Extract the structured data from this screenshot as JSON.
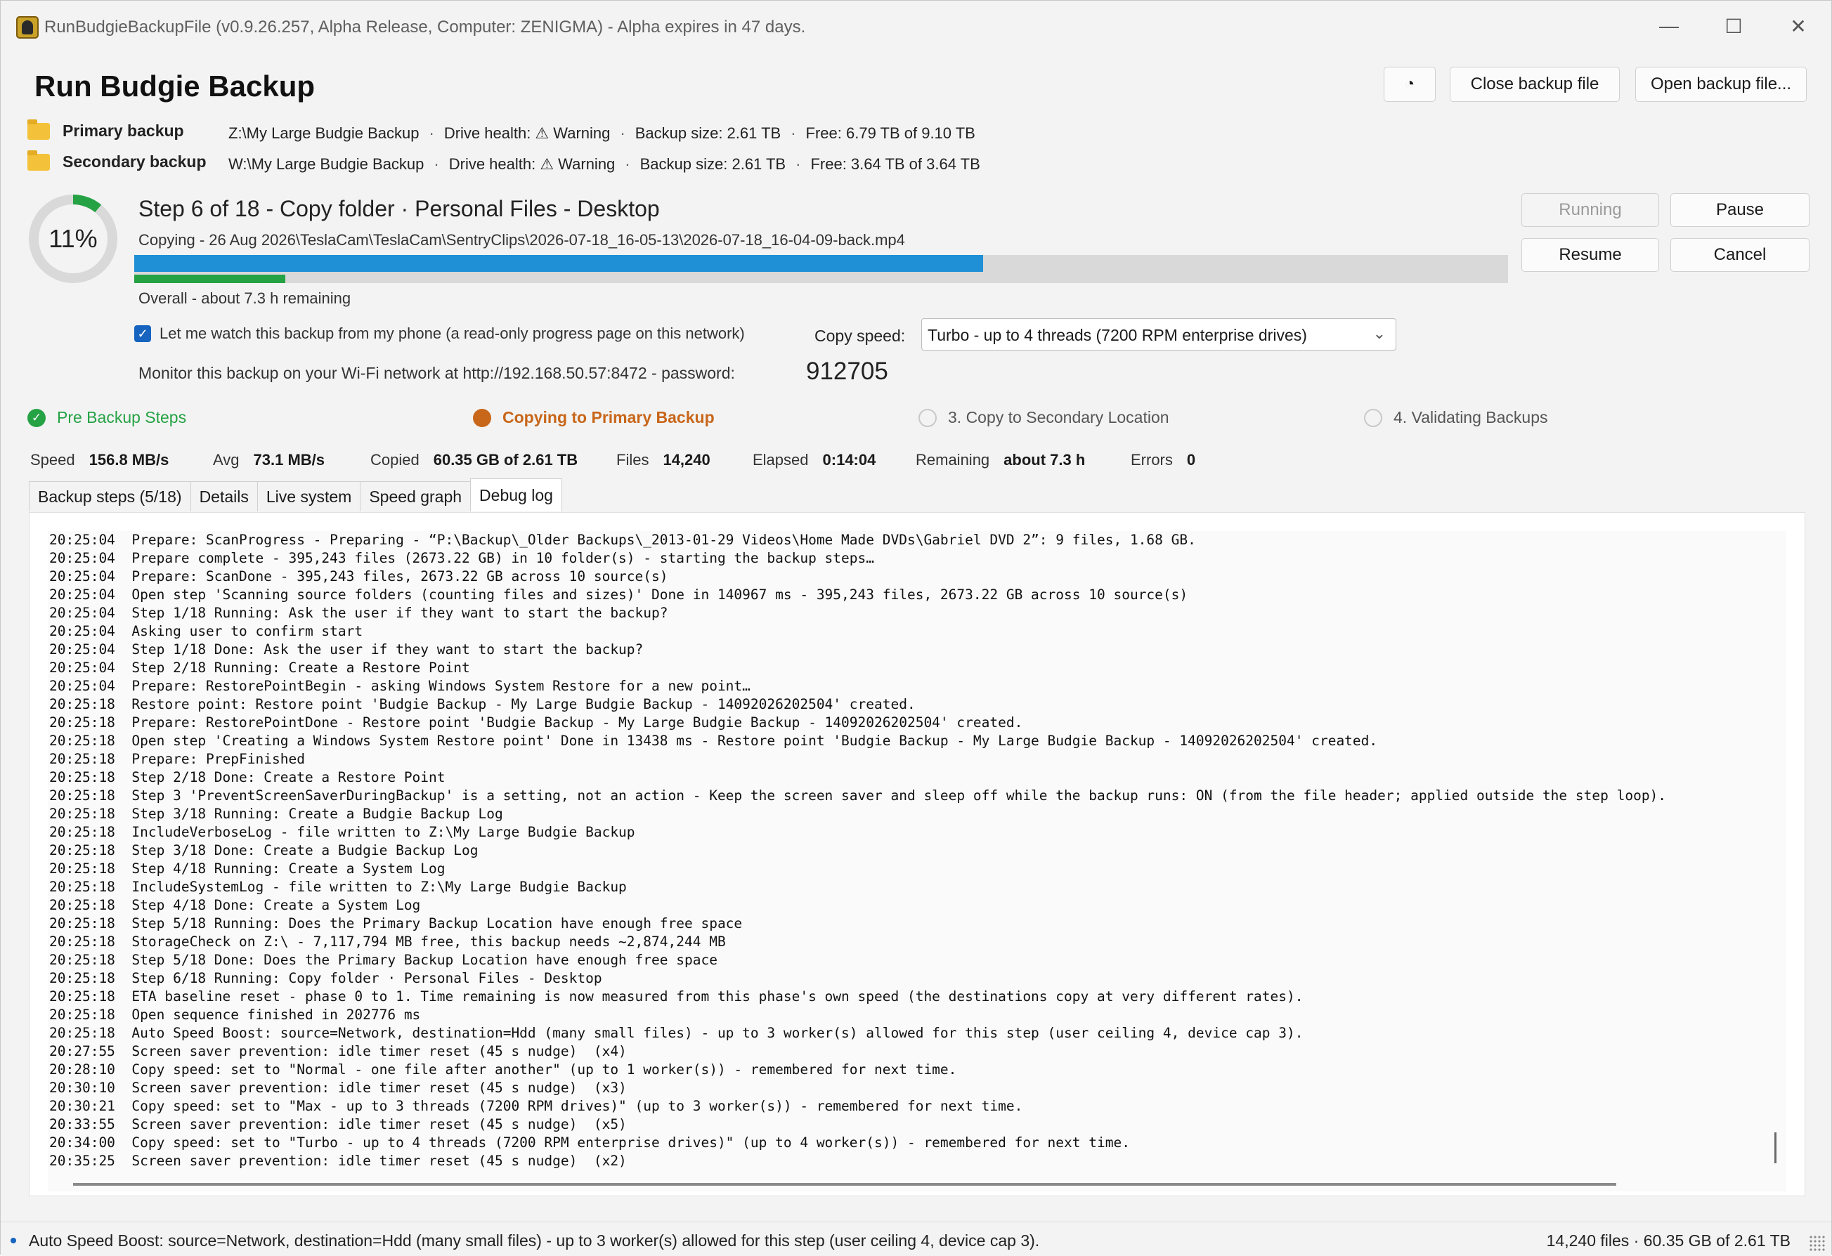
{
  "window": {
    "title": "RunBudgieBackupFile (v0.9.26.257, Alpha Release, Computer: ZENIGMA) - Alpha expires in 47 days.",
    "minimize_glyph": "—",
    "maximize_glyph": "☐",
    "close_glyph": "✕"
  },
  "header": {
    "title": "Run Budgie Backup",
    "close_file_label": "Close backup file",
    "open_file_label": "Open backup file...",
    "theme_glyph": "◔"
  },
  "drives": {
    "primary": {
      "label": "Primary backup",
      "path": "Z:\\My Large Budgie Backup",
      "health": "Drive health: ⚠ Warning",
      "size": "Backup size: 2.61 TB",
      "free": "Free: 6.79 TB of 9.10 TB"
    },
    "secondary": {
      "label": "Secondary backup",
      "path": "W:\\My Large Budgie Backup",
      "health": "Drive health: ⚠ Warning",
      "size": "Backup size: 2.61 TB",
      "free": "Free: 3.64 TB of 3.64 TB"
    },
    "separator": "·"
  },
  "progress": {
    "percent_label": "11%",
    "overall_fraction": 0.11,
    "step_title": "Step 6 of 18 - Copy folder · Personal Files - Desktop",
    "copying": "Copying - 26 Aug 2026\\TeslaCam\\TeslaCam\\SentryClips\\2026-07-18_16-05-13\\2026-07-18_16-04-09-back.mp4",
    "file_fraction": 0.618,
    "overall_text": "Overall - about 7.3 h remaining",
    "colors": {
      "file_bar": "#1f8fd6",
      "overall_bar": "#25a244",
      "track": "#d9d9d9"
    }
  },
  "controls": {
    "running": "Running",
    "pause": "Pause",
    "resume": "Resume",
    "cancel": "Cancel"
  },
  "phone": {
    "checked": true,
    "label": "Let me watch this backup from my phone (a read-only progress page on this network)",
    "copy_speed_label": "Copy speed:",
    "copy_speed_value": "Turbo - up to 4 threads (7200 RPM enterprise drives)",
    "monitor_text": "Monitor this backup on your Wi-Fi network at  http://192.168.50.57:8472  -  password:",
    "password": "912705"
  },
  "phases": [
    {
      "label": "Pre Backup Steps",
      "state": "done",
      "color": "#25a244"
    },
    {
      "label": "Copying to Primary Backup",
      "state": "active",
      "color": "#c8661a"
    },
    {
      "label": "3. Copy to Secondary Location",
      "state": "pending",
      "color": "#555555"
    },
    {
      "label": "4. Validating Backups",
      "state": "pending",
      "color": "#555555"
    }
  ],
  "stats": {
    "speed_label": "Speed",
    "speed": "156.8 MB/s",
    "avg_label": "Avg",
    "avg": "73.1 MB/s",
    "copied_label": "Copied",
    "copied": "60.35 GB of 2.61 TB",
    "files_label": "Files",
    "files": "14,240",
    "elapsed_label": "Elapsed",
    "elapsed": "0:14:04",
    "remaining_label": "Remaining",
    "remaining": "about 7.3 h",
    "errors_label": "Errors",
    "errors": "0"
  },
  "tabs": [
    {
      "label": "Backup steps (5/18)",
      "active": false
    },
    {
      "label": "Details",
      "active": false
    },
    {
      "label": "Live system",
      "active": false
    },
    {
      "label": "Speed graph",
      "active": false
    },
    {
      "label": "Debug log",
      "active": true
    }
  ],
  "log": [
    "20:25:04  Prepare: ScanProgress - Preparing - “P:\\Backup\\_Older Backups\\_2013-01-29 Videos\\Home Made DVDs\\Gabriel DVD 2”: 9 files, 1.68 GB.",
    "20:25:04  Prepare complete - 395,243 files (2673.22 GB) in 10 folder(s) - starting the backup steps…",
    "20:25:04  Prepare: ScanDone - 395,243 files, 2673.22 GB across 10 source(s)",
    "20:25:04  Open step 'Scanning source folders (counting files and sizes)' Done in 140967 ms - 395,243 files, 2673.22 GB across 10 source(s)",
    "20:25:04  Step 1/18 Running: Ask the user if they want to start the backup?",
    "20:25:04  Asking user to confirm start",
    "20:25:04  Step 1/18 Done: Ask the user if they want to start the backup?",
    "20:25:04  Step 2/18 Running: Create a Restore Point",
    "20:25:04  Prepare: RestorePointBegin - asking Windows System Restore for a new point…",
    "20:25:18  Restore point: Restore point 'Budgie Backup - My Large Budgie Backup - 14092026202504' created.",
    "20:25:18  Prepare: RestorePointDone - Restore point 'Budgie Backup - My Large Budgie Backup - 14092026202504' created.",
    "20:25:18  Open step 'Creating a Windows System Restore point' Done in 13438 ms - Restore point 'Budgie Backup - My Large Budgie Backup - 14092026202504' created.",
    "20:25:18  Prepare: PrepFinished",
    "20:25:18  Step 2/18 Done: Create a Restore Point",
    "20:25:18  Step 3 'PreventScreenSaverDuringBackup' is a setting, not an action - Keep the screen saver and sleep off while the backup runs: ON (from the file header; applied outside the step loop).",
    "20:25:18  Step 3/18 Running: Create a Budgie Backup Log",
    "20:25:18  IncludeVerboseLog - file written to Z:\\My Large Budgie Backup",
    "20:25:18  Step 3/18 Done: Create a Budgie Backup Log",
    "20:25:18  Step 4/18 Running: Create a System Log",
    "20:25:18  IncludeSystemLog - file written to Z:\\My Large Budgie Backup",
    "20:25:18  Step 4/18 Done: Create a System Log",
    "20:25:18  Step 5/18 Running: Does the Primary Backup Location have enough free space",
    "20:25:18  StorageCheck on Z:\\ - 7,117,794 MB free, this backup needs ~2,874,244 MB",
    "20:25:18  Step 5/18 Done: Does the Primary Backup Location have enough free space",
    "20:25:18  Step 6/18 Running: Copy folder · Personal Files - Desktop",
    "20:25:18  ETA baseline reset - phase 0 to 1. Time remaining is now measured from this phase's own speed (the destinations copy at very different rates).",
    "20:25:18  Open sequence finished in 202776 ms",
    "20:25:18  Auto Speed Boost: source=Network, destination=Hdd (many small files) - up to 3 worker(s) allowed for this step (user ceiling 4, device cap 3).",
    "20:27:55  Screen saver prevention: idle timer reset (45 s nudge)  (x4)",
    "20:28:10  Copy speed: set to \"Normal - one file after another\" (up to 1 worker(s)) - remembered for next time.",
    "20:30:10  Screen saver prevention: idle timer reset (45 s nudge)  (x3)",
    "20:30:21  Copy speed: set to \"Max - up to 3 threads (7200 RPM drives)\" (up to 3 worker(s)) - remembered for next time.",
    "20:33:55  Screen saver prevention: idle timer reset (45 s nudge)  (x5)",
    "20:34:00  Copy speed: set to \"Turbo - up to 4 threads (7200 RPM enterprise drives)\" (up to 4 worker(s)) - remembered for next time.",
    "20:35:25  Screen saver prevention: idle timer reset (45 s nudge)  (x2)"
  ],
  "status": {
    "message": "Auto Speed Boost: source=Network, destination=Hdd (many small files) - up to 3 worker(s) allowed for this step (user ceiling 4, device cap 3).",
    "summary": "14,240 files · 60.35 GB of 2.61 TB"
  }
}
